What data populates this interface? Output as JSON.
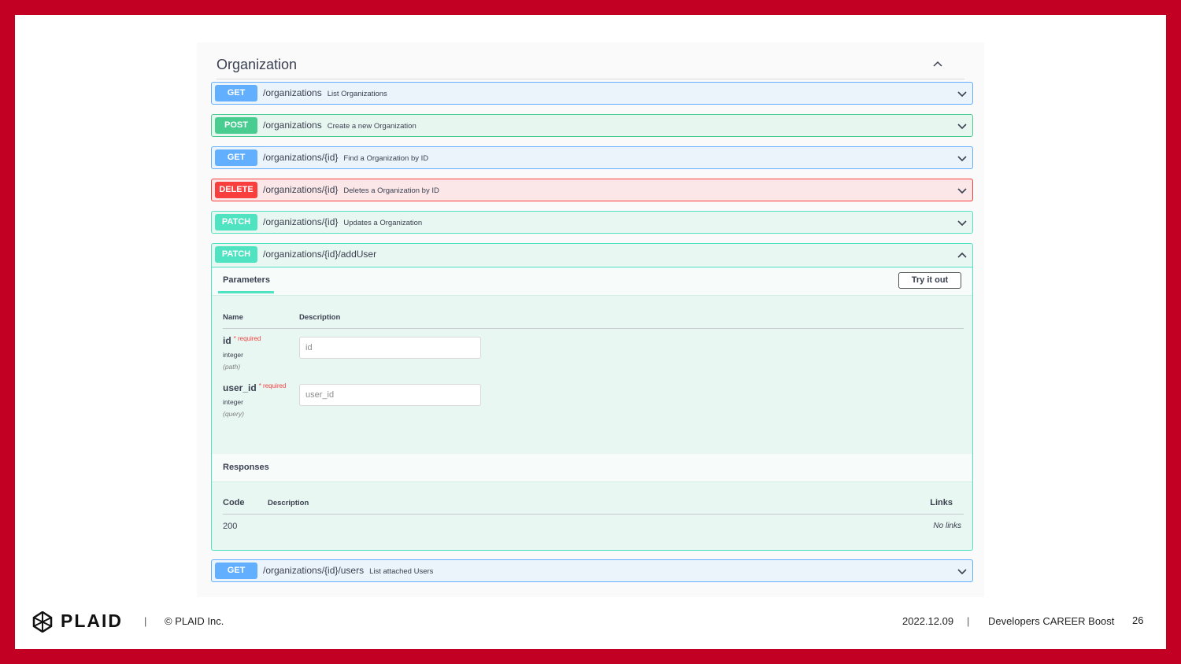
{
  "section": {
    "title": "Organization"
  },
  "operations": [
    {
      "method": "GET",
      "path": "/organizations",
      "summary": "List Organizations"
    },
    {
      "method": "POST",
      "path": "/organizations",
      "summary": "Create a new Organization"
    },
    {
      "method": "GET",
      "path": "/organizations/{id}",
      "summary": "Find a Organization by ID"
    },
    {
      "method": "DELETE",
      "path": "/organizations/{id}",
      "summary": "Deletes a Organization by ID"
    },
    {
      "method": "PATCH",
      "path": "/organizations/{id}",
      "summary": "Updates a Organization"
    },
    {
      "method": "PATCH",
      "path": "/organizations/{id}/addUser",
      "summary": ""
    },
    {
      "method": "GET",
      "path": "/organizations/{id}/users",
      "summary": "List attached Users"
    }
  ],
  "expanded": {
    "tab_label": "Parameters",
    "try_button": "Try it out",
    "col_name": "Name",
    "col_description": "Description",
    "params": [
      {
        "name": "id",
        "required": "* required",
        "type": "integer",
        "in": "(path)",
        "placeholder": "id"
      },
      {
        "name": "user_id",
        "required": "* required",
        "type": "integer",
        "in": "(query)",
        "placeholder": "user_id"
      }
    ],
    "responses_title": "Responses",
    "resp_col_code": "Code",
    "resp_col_description": "Description",
    "resp_col_links": "Links",
    "responses": [
      {
        "code": "200",
        "description": "",
        "links": "No links"
      }
    ]
  },
  "footer": {
    "brand": "PLAID",
    "separator": "|",
    "copyright": "© PLAID Inc.",
    "date": "2022.12.09",
    "event": "Developers CAREER Boost",
    "page": "26"
  },
  "colors": {
    "frame": "#c20023",
    "get": "#61affe",
    "post": "#49cc90",
    "delete": "#f93e3e",
    "patch": "#50e3c2"
  }
}
